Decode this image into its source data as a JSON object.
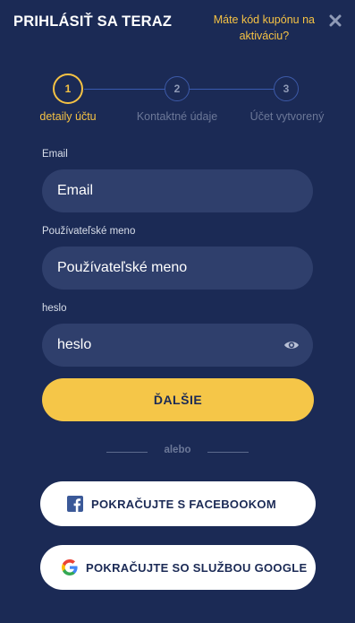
{
  "header": {
    "title": "PRIHLÁSIŤ SA TERAZ",
    "coupon_line1": "Máte kód kupónu na",
    "coupon_line2": "aktiváciu?"
  },
  "steps": [
    {
      "number": "1",
      "label": "detaily účtu",
      "active": true
    },
    {
      "number": "2",
      "label": "Kontaktné údaje",
      "active": false
    },
    {
      "number": "3",
      "label": "Účet vytvorený",
      "active": false
    }
  ],
  "form": {
    "email": {
      "label": "Email",
      "placeholder": "Email"
    },
    "username": {
      "label": "Používateľské meno",
      "placeholder": "Používateľské meno"
    },
    "password": {
      "label": "heslo",
      "placeholder": "heslo"
    }
  },
  "next_button": "ĎALŠIE",
  "divider_text": "alebo",
  "social": {
    "facebook": "POKRAČUJTE S FACEBOOKOM",
    "google": "POKRAČUJTE SO SLUŽBOU GOOGLE"
  },
  "colors": {
    "background": "#1b2a55",
    "accent": "#f5c648",
    "input_bg": "#2f3f6c"
  },
  "icons": [
    "close-icon",
    "eye-icon",
    "facebook-icon",
    "google-icon"
  ]
}
